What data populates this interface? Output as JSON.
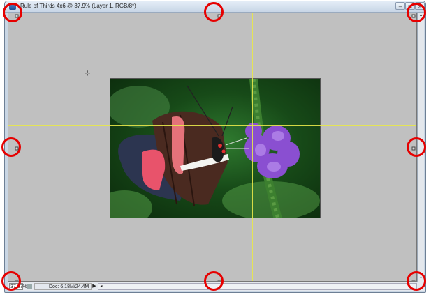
{
  "window": {
    "title": "Rule of Thirds 4x6 @ 37.9% (Layer 1, RGB/8*)",
    "controls": {
      "minimize": "–",
      "maximize": "□",
      "close": "×"
    }
  },
  "statusbar": {
    "zoom": "37.87%",
    "doc_info": "Doc: 6.18M/24.4M",
    "arrow": "▶",
    "scroll_left": "◂"
  },
  "scrollbar": {
    "up": "▴",
    "down": "▾"
  },
  "icons": {
    "app": "photoshop-icon",
    "cursor": "move-cursor-icon",
    "status": "document-status-icon"
  },
  "colors": {
    "annotation": "#e60000",
    "guide": "#e8e84a",
    "canvas": "#c0c0c0"
  },
  "content": {
    "photo": "butterfly-on-purple-flower",
    "guides": {
      "vertical": 2,
      "horizontal": 2
    },
    "annotated_handles": 8
  }
}
